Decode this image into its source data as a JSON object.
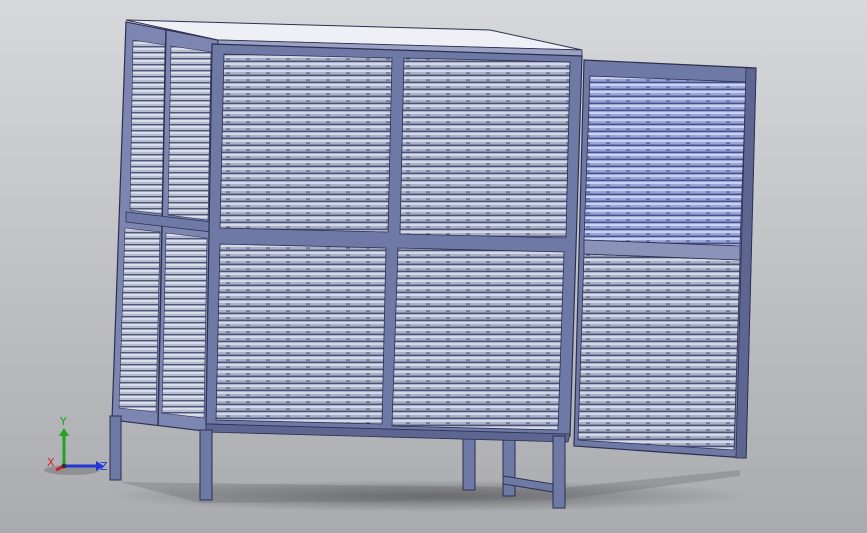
{
  "viewport": {
    "background_top": "#d6d8dc",
    "background_bottom": "#a9abaf"
  },
  "model": {
    "frame_color": "#6f79a6",
    "frame_edge": "#2b3050",
    "louver_light": "#c2c8dc",
    "louver_dark": "#4a5276",
    "louver_tint_panel": "#a9b4e4",
    "top_plate": "#eef0f6",
    "shadow": "#5c5d60"
  },
  "triad": {
    "labels": {
      "x": "X",
      "y": "Y",
      "z": "Z"
    },
    "colors": {
      "x": "#d62020",
      "y": "#1fa51f",
      "z": "#2236d8"
    }
  }
}
